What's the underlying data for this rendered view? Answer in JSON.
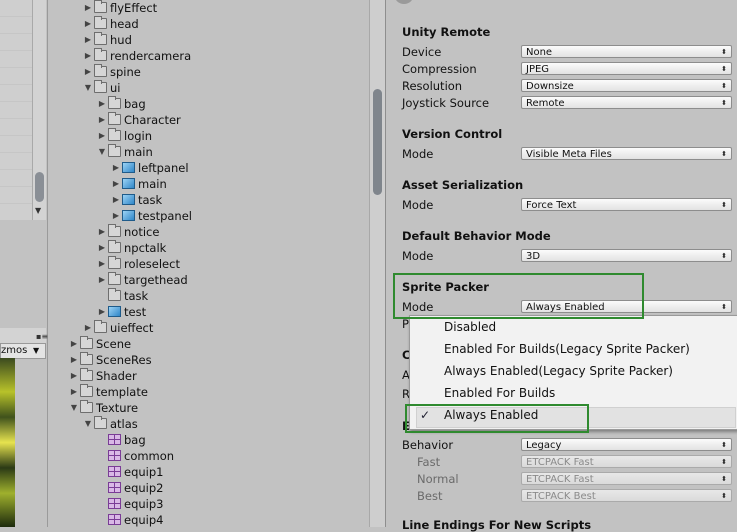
{
  "gizmos_tab": "zmos",
  "tree": [
    {
      "label": "flyEffect",
      "icon": "folder",
      "depth": 1,
      "arrow": "right"
    },
    {
      "label": "head",
      "icon": "folder",
      "depth": 1,
      "arrow": "right"
    },
    {
      "label": "hud",
      "icon": "folder",
      "depth": 1,
      "arrow": "right"
    },
    {
      "label": "rendercamera",
      "icon": "folder",
      "depth": 1,
      "arrow": "right"
    },
    {
      "label": "spine",
      "icon": "folder",
      "depth": 1,
      "arrow": "right"
    },
    {
      "label": "ui",
      "icon": "folder",
      "depth": 1,
      "arrow": "down"
    },
    {
      "label": "bag",
      "icon": "folder",
      "depth": 2,
      "arrow": "right"
    },
    {
      "label": "Character",
      "icon": "folder",
      "depth": 2,
      "arrow": "right"
    },
    {
      "label": "login",
      "icon": "folder",
      "depth": 2,
      "arrow": "right"
    },
    {
      "label": "main",
      "icon": "folder",
      "depth": 2,
      "arrow": "down"
    },
    {
      "label": "leftpanel",
      "icon": "prefab",
      "depth": 3,
      "arrow": "right"
    },
    {
      "label": "main",
      "icon": "prefab",
      "depth": 3,
      "arrow": "right"
    },
    {
      "label": "task",
      "icon": "prefab",
      "depth": 3,
      "arrow": "right"
    },
    {
      "label": "testpanel",
      "icon": "prefab",
      "depth": 3,
      "arrow": "right"
    },
    {
      "label": "notice",
      "icon": "folder",
      "depth": 2,
      "arrow": "right"
    },
    {
      "label": "npctalk",
      "icon": "folder",
      "depth": 2,
      "arrow": "right"
    },
    {
      "label": "roleselect",
      "icon": "folder",
      "depth": 2,
      "arrow": "right"
    },
    {
      "label": "targethead",
      "icon": "folder",
      "depth": 2,
      "arrow": "right"
    },
    {
      "label": "task",
      "icon": "folder",
      "depth": 2,
      "arrow": ""
    },
    {
      "label": "test",
      "icon": "prefab",
      "depth": 2,
      "arrow": "right"
    },
    {
      "label": "uieffect",
      "icon": "folder",
      "depth": 1,
      "arrow": "right"
    },
    {
      "label": "Scene",
      "icon": "folder",
      "depth": 0,
      "arrow": "right"
    },
    {
      "label": "SceneRes",
      "icon": "folder",
      "depth": 0,
      "arrow": "right"
    },
    {
      "label": "Shader",
      "icon": "folder",
      "depth": 0,
      "arrow": "right"
    },
    {
      "label": "template",
      "icon": "folder",
      "depth": 0,
      "arrow": "right"
    },
    {
      "label": "Texture",
      "icon": "folder",
      "depth": 0,
      "arrow": "down"
    },
    {
      "label": "atlas",
      "icon": "folder",
      "depth": 1,
      "arrow": "down"
    },
    {
      "label": "bag",
      "icon": "sprite",
      "depth": 2,
      "arrow": ""
    },
    {
      "label": "common",
      "icon": "sprite",
      "depth": 2,
      "arrow": ""
    },
    {
      "label": "equip1",
      "icon": "sprite",
      "depth": 2,
      "arrow": ""
    },
    {
      "label": "equip2",
      "icon": "sprite",
      "depth": 2,
      "arrow": ""
    },
    {
      "label": "equip3",
      "icon": "sprite",
      "depth": 2,
      "arrow": ""
    },
    {
      "label": "equip4",
      "icon": "sprite",
      "depth": 2,
      "arrow": ""
    }
  ],
  "inspector": {
    "unity_remote": {
      "title": "Unity Remote",
      "device": {
        "label": "Device",
        "value": "None"
      },
      "compression": {
        "label": "Compression",
        "value": "JPEG"
      },
      "resolution": {
        "label": "Resolution",
        "value": "Downsize"
      },
      "joystick": {
        "label": "Joystick Source",
        "value": "Remote"
      }
    },
    "version_control": {
      "title": "Version Control",
      "mode": {
        "label": "Mode",
        "value": "Visible Meta Files"
      }
    },
    "asset_serialization": {
      "title": "Asset Serialization",
      "mode": {
        "label": "Mode",
        "value": "Force Text"
      }
    },
    "default_behavior": {
      "title": "Default Behavior Mode",
      "mode": {
        "label": "Mode",
        "value": "3D"
      }
    },
    "sprite_packer": {
      "title": "Sprite Packer",
      "mode": {
        "label": "Mode",
        "value": "Always Enabled"
      },
      "peek_p": "P"
    },
    "peek_c": "C",
    "peek_a": "A",
    "peek_r": "R",
    "peek_e": "E",
    "etc": {
      "behavior": {
        "label": "Behavior",
        "value": "Legacy"
      },
      "fast": {
        "label": "Fast",
        "value": "ETCPACK Fast"
      },
      "normal": {
        "label": "Normal",
        "value": "ETCPACK Fast"
      },
      "best": {
        "label": "Best",
        "value": "ETCPACK Best"
      }
    },
    "line_endings_title": "Line Endings For New Scripts"
  },
  "popup": {
    "options": [
      "Disabled",
      "Enabled For Builds(Legacy Sprite Packer)",
      "Always Enabled(Legacy Sprite Packer)",
      "Enabled For Builds",
      "Always Enabled"
    ],
    "selected_index": 4,
    "check": "✓"
  },
  "highlight_color": "#2f8a2f"
}
